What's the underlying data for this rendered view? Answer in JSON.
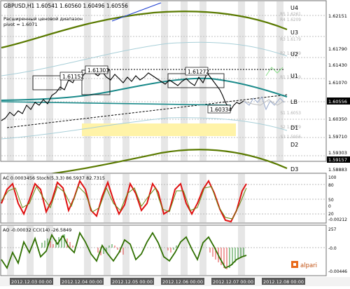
{
  "header": {
    "symbol_line": "GBPUSD,H1  1.60541 1.60560 1.60496 1.60556",
    "subtitle_1": "Расширенный ценовой диапазон",
    "subtitle_2": "pivot = 1.6071"
  },
  "price_axis": {
    "ticks": [
      "1.62151",
      "1.61790",
      "1.61430",
      "1.61070",
      "1.60556",
      "1.60350",
      "1.59710",
      "1.59303",
      "1.58883"
    ],
    "current_price": "1.60556",
    "low_label": "1.59157"
  },
  "levels": {
    "right_labels": [
      "U4",
      "U3",
      "U2",
      "U1",
      "LB",
      "D1",
      "D2",
      "D3"
    ],
    "inner_labels": [
      "R5 1.6261",
      "R4 1.6209",
      "R3 1.6179",
      "R2 1.6149",
      "R1 1.6119",
      "S1 1.6053",
      "S2 1.5979",
      "S3 1.5956"
    ]
  },
  "annotations": {
    "high_a": "1.61152",
    "high_b": "1.61303",
    "high_c": "1.61272",
    "low_a": "1.60334"
  },
  "ac_stoch": {
    "label": "AC 0.0003456  Stoch(5,3,3) 86.5937 82.7315",
    "right_ticks": [
      "100",
      "80",
      "50",
      "20",
      "0",
      "-0.00212"
    ]
  },
  "ao_cci": {
    "label": "AO -0.00032  CCI(14) -26.5849",
    "right_ticks": [
      "257",
      "-0.0",
      "-0.00446"
    ]
  },
  "time_axis": {
    "labels": [
      "2012.12.03 00:00",
      "2012.12.04 00:00",
      "2012.12.05 00:00",
      "2012.12.06 00:00",
      "2012.12.07 00:00",
      "2012.12.08 00:00"
    ]
  },
  "watermark": "alpari",
  "colors": {
    "price_line": "#000000",
    "ema_teal": "#1a8a8a",
    "envelope_olive": "#5a7a00",
    "red_osc": "#e01010",
    "green_osc": "#2f6f00",
    "yellow_zone": "#fff3a8"
  }
}
